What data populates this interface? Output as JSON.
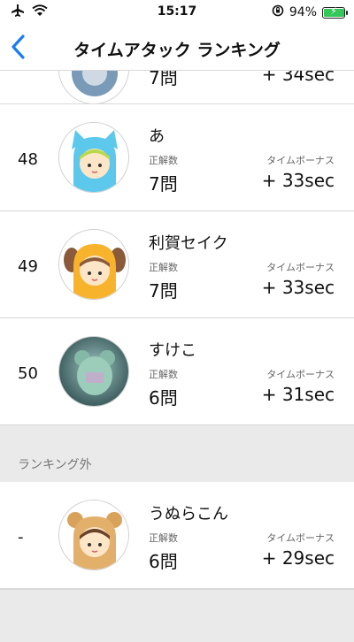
{
  "status": {
    "time": "15:17",
    "battery": "94%",
    "battery_level": 0.94
  },
  "nav": {
    "title": "タイムアタック ランキング"
  },
  "labels": {
    "correct": "正解数",
    "bonus": "タイムボーナス"
  },
  "partial_row": {
    "correct": "7問",
    "bonus": "+ 34sec"
  },
  "rows": [
    {
      "rank": "48",
      "name": "あ",
      "correct": "7問",
      "bonus": "+ 33sec"
    },
    {
      "rank": "49",
      "name": "利賀セイク",
      "correct": "7問",
      "bonus": "+ 33sec"
    },
    {
      "rank": "50",
      "name": "すけこ",
      "correct": "6問",
      "bonus": "+ 31sec"
    }
  ],
  "outside": {
    "section_label": "ランキング外",
    "row": {
      "rank": "-",
      "name": "うぬらこん",
      "correct": "6問",
      "bonus": "+ 29sec"
    }
  }
}
